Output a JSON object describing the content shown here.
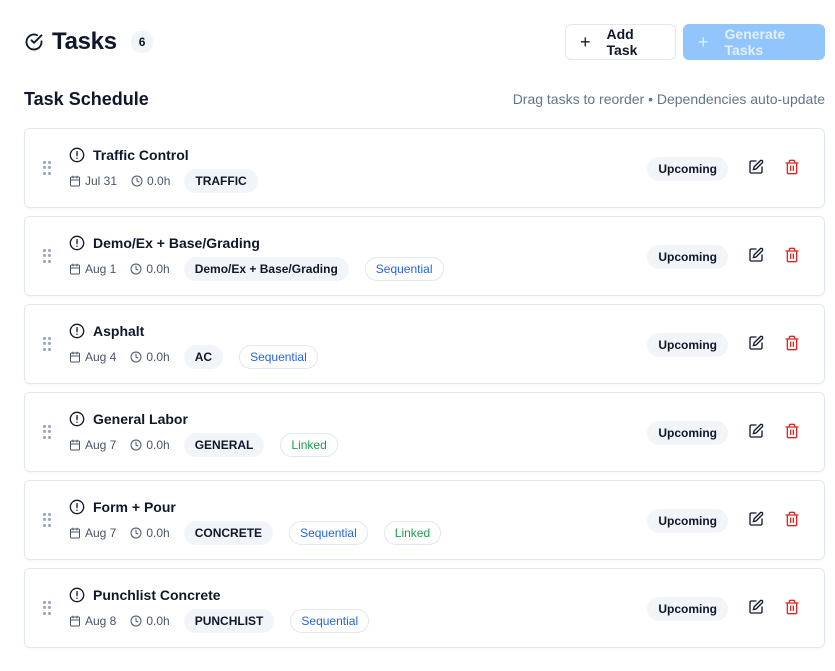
{
  "header": {
    "title": "Tasks",
    "count": "6",
    "add_task_label": "Add Task",
    "generate_tasks_label": "Generate Tasks"
  },
  "section": {
    "title": "Task Schedule",
    "hint": "Drag tasks to reorder • Dependencies auto-update"
  },
  "colors": {
    "primary_disabled": "#93c5fd",
    "sequential": "#2563eb",
    "linked": "#16a34a",
    "delete": "#dc2626"
  },
  "tasks": [
    {
      "name": "Traffic Control",
      "date": "Jul 31",
      "hours": "0.0h",
      "category": "TRAFFIC",
      "tags": [],
      "status": "Upcoming"
    },
    {
      "name": "Demo/Ex + Base/Grading",
      "date": "Aug 1",
      "hours": "0.0h",
      "category": "Demo/Ex + Base/Grading",
      "tags": [
        {
          "label": "Sequential",
          "kind": "sequential"
        }
      ],
      "status": "Upcoming"
    },
    {
      "name": "Asphalt",
      "date": "Aug 4",
      "hours": "0.0h",
      "category": "AC",
      "tags": [
        {
          "label": "Sequential",
          "kind": "sequential"
        }
      ],
      "status": "Upcoming"
    },
    {
      "name": "General Labor",
      "date": "Aug 7",
      "hours": "0.0h",
      "category": "GENERAL",
      "tags": [
        {
          "label": "Linked",
          "kind": "linked"
        }
      ],
      "status": "Upcoming"
    },
    {
      "name": "Form + Pour",
      "date": "Aug 7",
      "hours": "0.0h",
      "category": "CONCRETE",
      "tags": [
        {
          "label": "Sequential",
          "kind": "sequential"
        },
        {
          "label": "Linked",
          "kind": "linked"
        }
      ],
      "status": "Upcoming"
    },
    {
      "name": "Punchlist Concrete",
      "date": "Aug 8",
      "hours": "0.0h",
      "category": "PUNCHLIST",
      "tags": [
        {
          "label": "Sequential",
          "kind": "sequential"
        }
      ],
      "status": "Upcoming"
    }
  ]
}
